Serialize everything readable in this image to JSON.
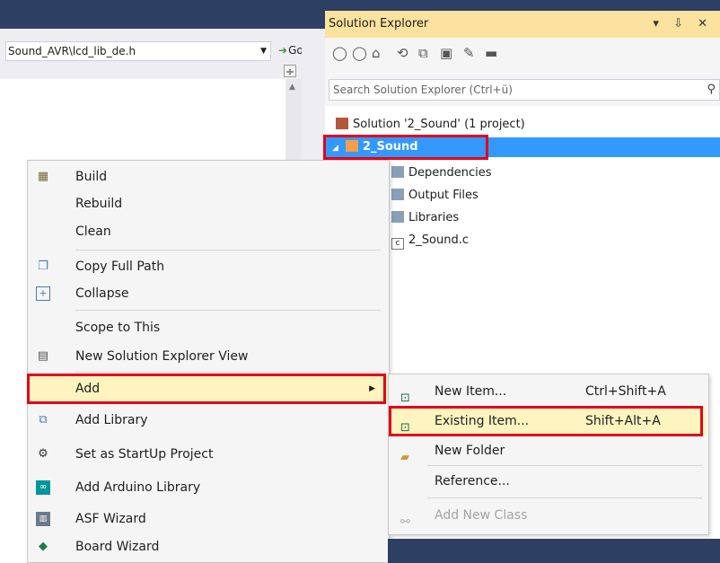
{
  "editor": {
    "file_path": "Sound_AVR\\lcd_lib_de.h",
    "go_label": "Go"
  },
  "solution_explorer": {
    "title": "Solution Explorer",
    "title_controls": "▾ ⇩ ✕",
    "search_placeholder": "Search Solution Explorer (Ctrl+ü)",
    "tree": [
      {
        "label": "Solution '2_Sound' (1 project)",
        "icon": "solution-icon"
      },
      {
        "label": "2_Sound",
        "icon": "project-icon",
        "selected": true
      },
      {
        "label": "Dependencies",
        "icon": "folder-icon"
      },
      {
        "label": "Output Files",
        "icon": "folder-icon"
      },
      {
        "label": "Libraries",
        "icon": "folder-icon"
      },
      {
        "label": "2_Sound.c",
        "icon": "c-file-icon"
      }
    ]
  },
  "context_menu": {
    "items": [
      {
        "label": "Build",
        "icon": "build-icon"
      },
      {
        "label": "Rebuild"
      },
      {
        "label": "Clean"
      },
      {
        "label": "Copy Full Path",
        "icon": "copy-icon"
      },
      {
        "label": "Collapse",
        "icon": "collapse-icon"
      },
      {
        "label": "Scope to This"
      },
      {
        "label": "New Solution Explorer View",
        "icon": "new-view-icon"
      },
      {
        "label": "Add",
        "highlighted": true,
        "has_submenu": true
      },
      {
        "label": "Add Library",
        "icon": "library-icon"
      },
      {
        "label": "Set as StartUp Project",
        "icon": "gear-icon"
      },
      {
        "label": "Add Arduino Library",
        "icon": "arduino-icon"
      },
      {
        "label": "ASF Wizard",
        "icon": "asf-icon"
      },
      {
        "label": "Board Wizard",
        "icon": "board-icon"
      }
    ]
  },
  "add_submenu": {
    "items": [
      {
        "label": "New Item...",
        "shortcut": "Ctrl+Shift+A",
        "icon": "new-item-icon"
      },
      {
        "label": "Existing Item...",
        "shortcut": "Shift+Alt+A",
        "icon": "existing-item-icon",
        "highlighted": true
      },
      {
        "label": "New Folder",
        "icon": "new-folder-icon"
      },
      {
        "label": "Reference..."
      },
      {
        "label": "Add New Class",
        "icon": "add-class-icon",
        "disabled": true
      }
    ]
  },
  "colors": {
    "highlight_box": "#e3001b",
    "hover_row": "#fdf4bf",
    "selected_row": "#3399ff",
    "title_bar": "#fbe29f"
  }
}
